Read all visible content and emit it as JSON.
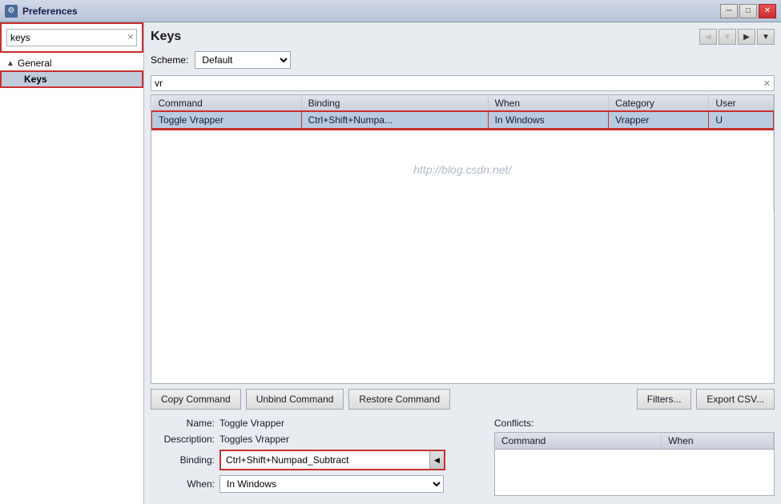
{
  "titleBar": {
    "title": "Preferences",
    "minBtn": "─",
    "maxBtn": "□",
    "closeBtn": "✕"
  },
  "sidebar": {
    "searchPlaceholder": "keys",
    "searchValue": "keys",
    "treeItems": [
      {
        "label": "General",
        "type": "parent",
        "arrow": "▲"
      },
      {
        "label": "Keys",
        "type": "child"
      }
    ]
  },
  "content": {
    "title": "Keys",
    "nav": {
      "backLabel": "◀",
      "forwardLabel": "▶",
      "dropdownLabel": "▼"
    },
    "scheme": {
      "label": "Scheme:",
      "value": "Default",
      "options": [
        "Default"
      ]
    },
    "filterValue": "vr",
    "table": {
      "columns": [
        "Command",
        "Binding",
        "When",
        "Category",
        "User"
      ],
      "rows": [
        {
          "command": "Toggle Vrapper",
          "binding": "Ctrl+Shift+Numpa...",
          "when": "In Windows",
          "category": "Vrapper",
          "user": "U",
          "selected": true
        }
      ],
      "watermark": "http://blog.csdn.net/"
    },
    "buttons": {
      "copyCommand": "Copy Command",
      "unbindCommand": "Unbind Command",
      "restoreCommand": "Restore Command",
      "filters": "Filters...",
      "exportCsv": "Export CSV..."
    },
    "detail": {
      "nameLabel": "Name:",
      "nameValue": "Toggle Vrapper",
      "descriptionLabel": "Description:",
      "descriptionValue": "Toggles Vrapper",
      "bindingLabel": "Binding:",
      "bindingValue": "Ctrl+Shift+Numpad_Subtract",
      "whenLabel": "When:",
      "whenValue": "In Windows",
      "whenOptions": [
        "In Windows"
      ]
    },
    "conflicts": {
      "label": "Conflicts:",
      "columns": [
        "Command",
        "When"
      ]
    }
  }
}
